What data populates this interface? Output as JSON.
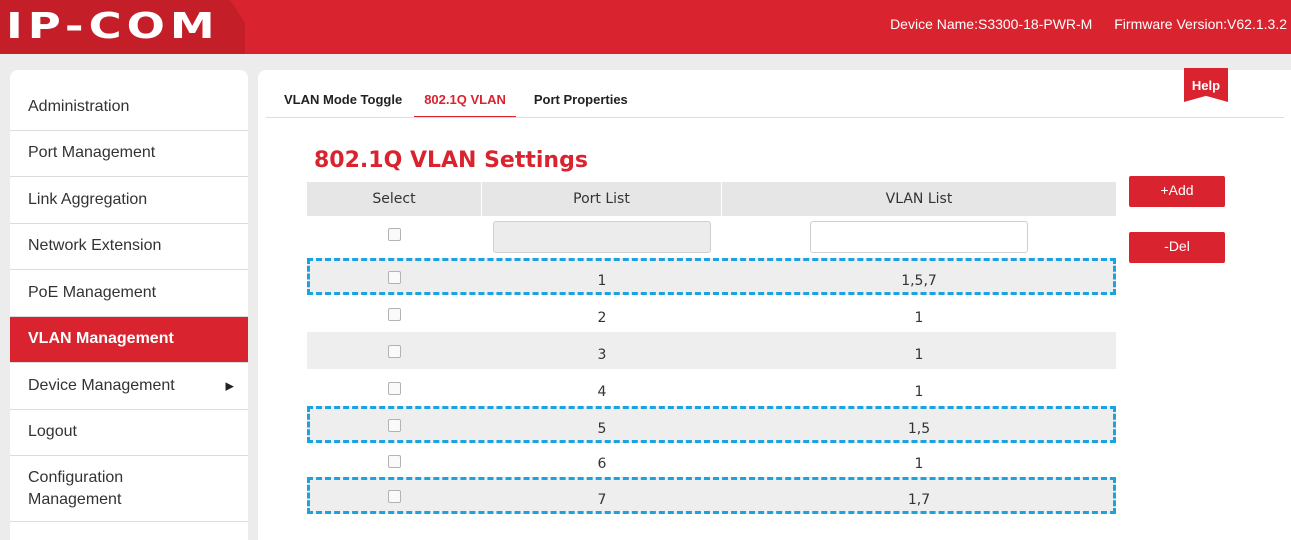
{
  "header": {
    "logo": "IP-COM",
    "device_name": "Device Name:S3300-18-PWR-M",
    "firmware": "Firmware Version:V62.1.3.2"
  },
  "sidebar": {
    "items": [
      {
        "label": "Administration",
        "active": false
      },
      {
        "label": "Port Management",
        "active": false
      },
      {
        "label": "Link Aggregation",
        "active": false
      },
      {
        "label": "Network Extension",
        "active": false
      },
      {
        "label": "PoE Management",
        "active": false
      },
      {
        "label": "VLAN Management",
        "active": true
      },
      {
        "label": "Device Management",
        "active": false,
        "submenu_arrow": "▶"
      },
      {
        "label": "Logout",
        "active": false
      },
      {
        "label": "Configuration Management",
        "active": false
      }
    ]
  },
  "tabs": [
    {
      "label": "VLAN Mode Toggle",
      "active": false
    },
    {
      "label": "802.1Q VLAN",
      "active": true
    },
    {
      "label": "Port Properties",
      "active": false
    }
  ],
  "help_label": "Help",
  "page_title": "802.1Q VLAN Settings",
  "table": {
    "columns": [
      "Select",
      "Port List",
      "VLAN List"
    ],
    "input_row": {
      "port_value": "",
      "vlan_value": ""
    },
    "rows": [
      {
        "port": "1",
        "vlan": "1,5,7",
        "highlighted": true
      },
      {
        "port": "2",
        "vlan": "1",
        "highlighted": false
      },
      {
        "port": "3",
        "vlan": "1",
        "highlighted": false
      },
      {
        "port": "4",
        "vlan": "1",
        "highlighted": false
      },
      {
        "port": "5",
        "vlan": "1,5",
        "highlighted": true
      },
      {
        "port": "6",
        "vlan": "1",
        "highlighted": false
      },
      {
        "port": "7",
        "vlan": "1,7",
        "highlighted": true
      }
    ]
  },
  "buttons": {
    "add": "+Add",
    "del": "-Del"
  },
  "colors": {
    "brand_red": "#d9232e",
    "highlight_dash": "#1aa3e0"
  }
}
